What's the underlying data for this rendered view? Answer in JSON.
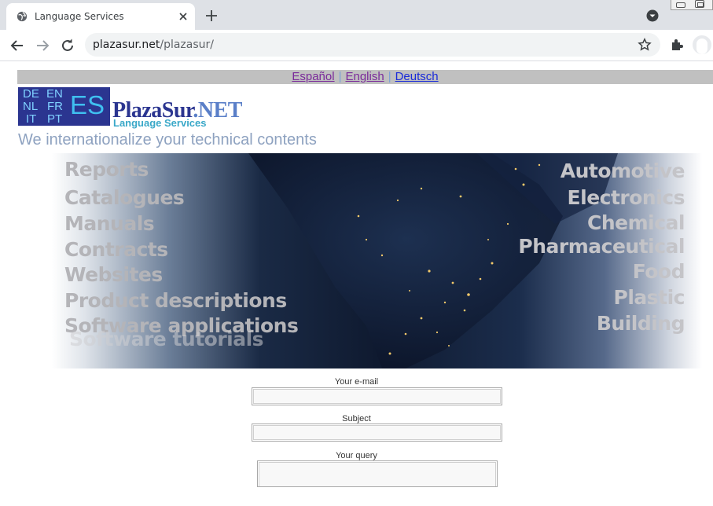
{
  "browser": {
    "tab_title": "Language Services",
    "url_host": "plazasur.net",
    "url_path": "/plazasur/",
    "icons": [
      "globe-icon",
      "close-icon",
      "plus-icon",
      "chevron-down-icon",
      "back-arrow-icon",
      "forward-arrow-icon",
      "reload-icon",
      "star-icon",
      "puzzle-icon",
      "profile-avatar-icon"
    ]
  },
  "languages": {
    "es": "Español",
    "en": "English",
    "de": "Deutsch",
    "separator": "|"
  },
  "logo": {
    "codes": [
      "DE",
      "EN",
      "NL",
      "FR",
      "IT",
      "PT"
    ],
    "big_code": "ES",
    "name_main": "PlazaSur",
    "name_ext": ".NET",
    "subtitle": "Language Services"
  },
  "tagline": "We internationalize your technical contents",
  "banner": {
    "left_words": [
      "Reports",
      "Catalogues",
      "Manuals",
      "Contracts",
      "Websites",
      "Product descriptions",
      "Software applications"
    ],
    "left_ghost": "Software tutorials",
    "right_words": [
      "Automotive",
      "Electronics",
      "Chemical",
      "Pharmaceutical",
      "Food",
      "Plastic",
      "Building"
    ]
  },
  "form": {
    "email_label": "Your e-mail",
    "subject_label": "Subject",
    "query_label": "Your query"
  },
  "colors": {
    "lang_bar": "#c0c0c0",
    "logo_navy": "#2b3590",
    "tagline": "#8ea2c0"
  }
}
